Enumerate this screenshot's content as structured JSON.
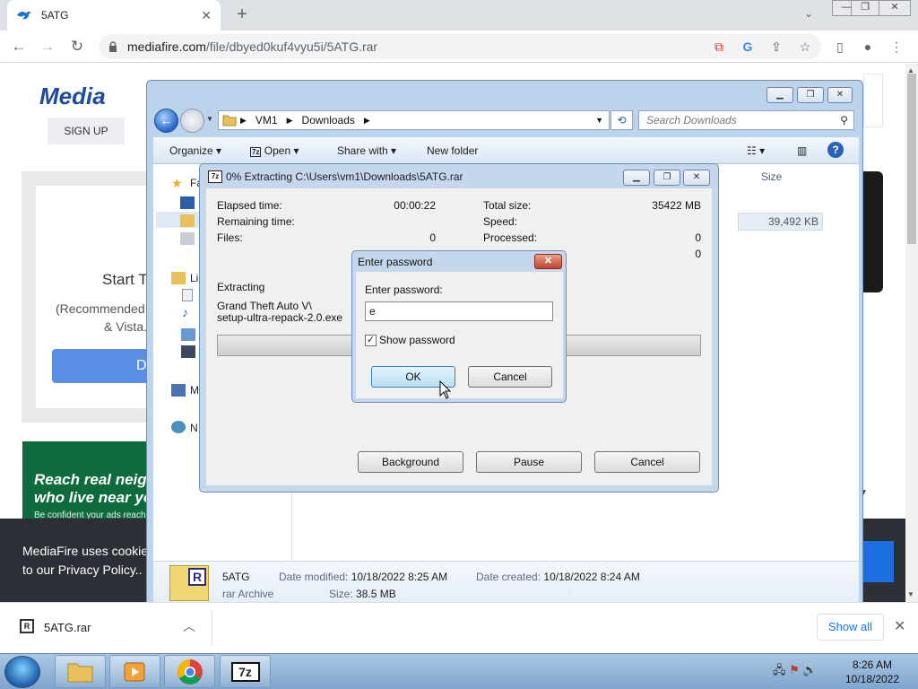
{
  "browser": {
    "tab_title": "5ATG",
    "url_host": "mediafire.com",
    "url_path": "/file/dbyed0kuf4vyu5i/5ATG.rar"
  },
  "page": {
    "logo": "Media",
    "signup": "SIGN UP",
    "start_text": "Start T",
    "recommended_line1": "(Recommended",
    "recommended_line2": "& Vista.",
    "download_fragment": "D",
    "ad_line1": "Reach real neigh",
    "ad_line2": "who live near yo",
    "ad_line3": "Be confident your ads reach r",
    "cookie_line1": "MediaFire uses cookies",
    "cookie_line2": "to our Privacy Policy.."
  },
  "download_bar": {
    "file_name": "5ATG.rar",
    "show_all": "Show all"
  },
  "explorer": {
    "address_parts": [
      "VM1",
      "Downloads"
    ],
    "search_placeholder": "Search Downloads",
    "commands": {
      "organize": "Organize",
      "open": "Open",
      "share_with": "Share with",
      "new_folder": "New folder"
    },
    "nav": {
      "favorites_fragment": "Fa",
      "libraries_fragment": "Li",
      "computer_fragment": "M",
      "network_fragment": "N"
    },
    "column_size": "Size",
    "selected_row_size": "39,492 KB",
    "details": {
      "name": "5ATG",
      "type": "rar Archive",
      "date_modified_label": "Date modified:",
      "date_modified": "10/18/2022 8:25 AM",
      "size_label": "Size:",
      "size": "38.5 MB",
      "date_created_label": "Date created:",
      "date_created": "10/18/2022 8:24 AM"
    }
  },
  "sevenzip": {
    "title": "0% Extracting C:\\Users\\vm1\\Downloads\\5ATG.rar",
    "elapsed_label": "Elapsed time:",
    "elapsed_value": "00:00:22",
    "remaining_label": "Remaining time:",
    "files_label": "Files:",
    "files_value": "0",
    "total_size_label": "Total size:",
    "total_size_value": "35422 MB",
    "speed_label": "Speed:",
    "processed_label": "Processed:",
    "processed_value": "0",
    "extra_value": "0",
    "extracting_label": "Extracting",
    "extracting_path1": "Grand Theft Auto V\\",
    "extracting_path2": "setup-ultra-repack-2.0.exe",
    "progress": 0,
    "background_button": "Background",
    "pause_button": "Pause",
    "cancel_button": "Cancel"
  },
  "password_dialog": {
    "title": "Enter password",
    "label": "Enter password:",
    "value": "e",
    "show_password_label": "Show password",
    "show_password_checked": true,
    "ok_button": "OK",
    "cancel_button": "Cancel"
  },
  "taskbar": {
    "time": "8:26 AM",
    "date": "10/18/2022",
    "sevenzip_label": "7z"
  }
}
